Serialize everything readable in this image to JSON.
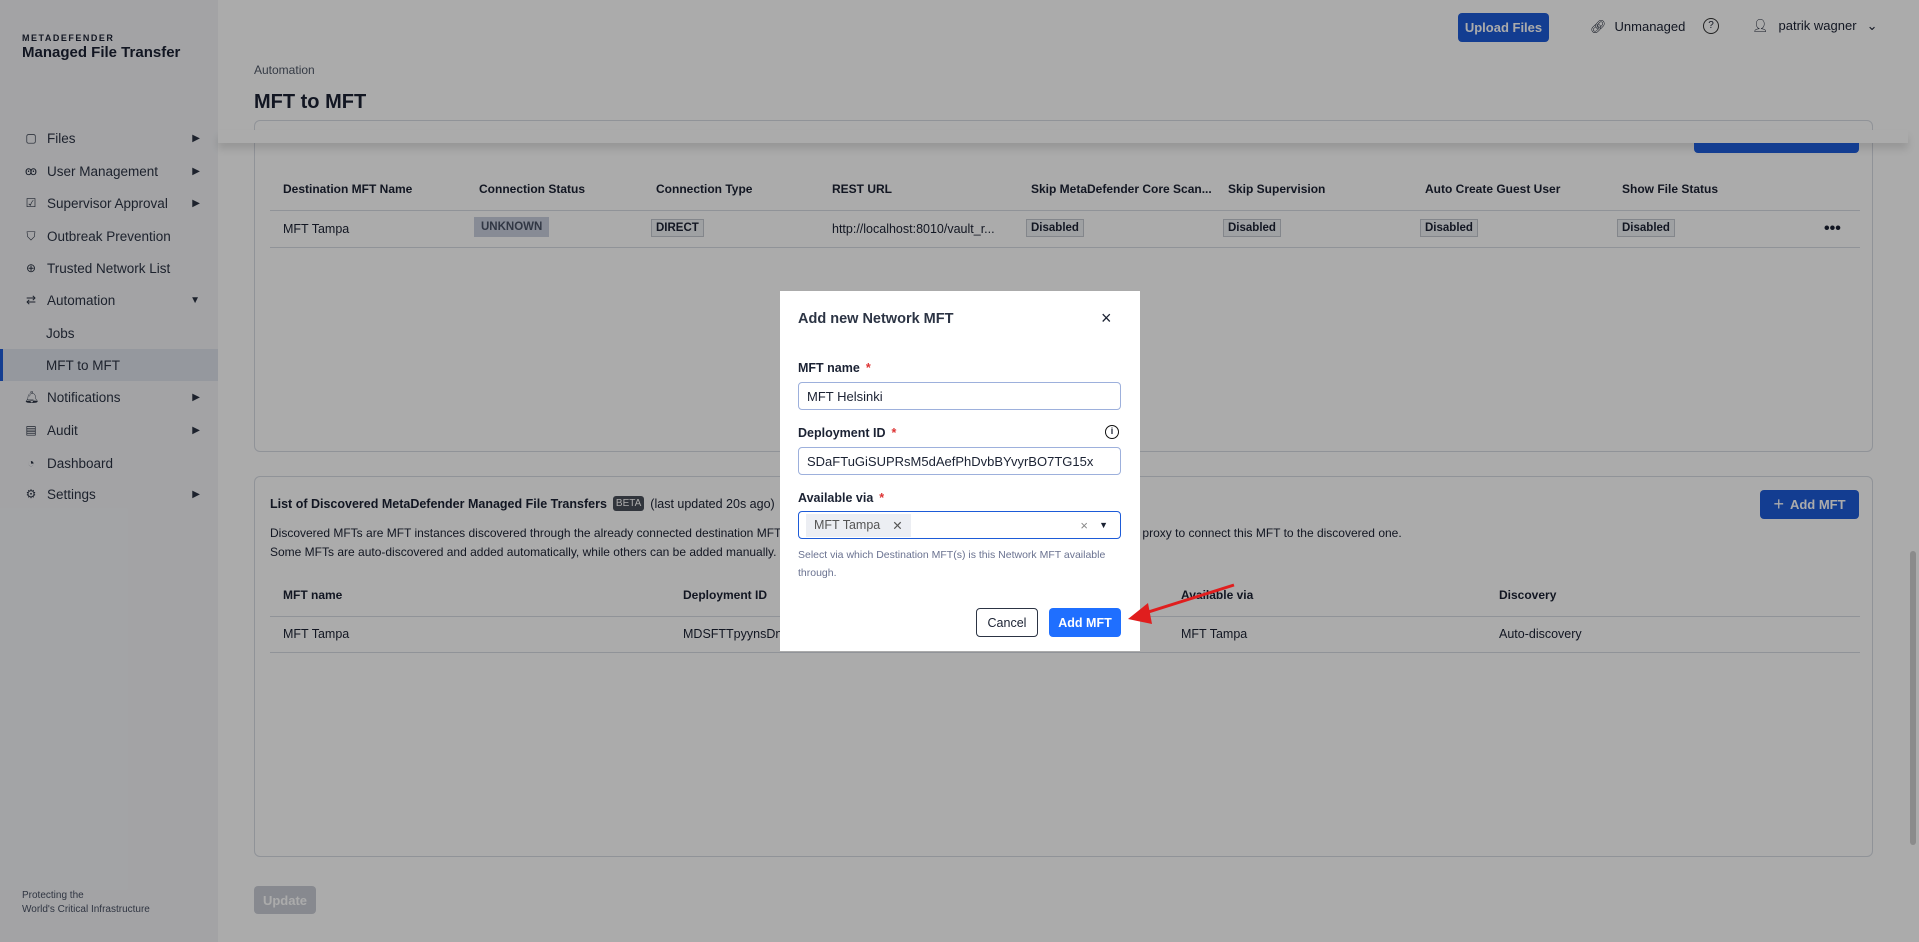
{
  "brand": {
    "top": "METADEFENDER",
    "name": "Managed File Transfer",
    "tagline_1": "Protecting the",
    "tagline_2": "World's Critical Infrastructure"
  },
  "header": {
    "upload": "Upload Files",
    "unmanaged": "Unmanaged",
    "user": "patrik wagner"
  },
  "sidebar": {
    "items": [
      {
        "label": "Files",
        "icon": "files-icon"
      },
      {
        "label": "User Management",
        "icon": "users-icon"
      },
      {
        "label": "Supervisor Approval",
        "icon": "approval-icon"
      },
      {
        "label": "Outbreak Prevention",
        "icon": "shield-icon"
      },
      {
        "label": "Trusted Network List",
        "icon": "globe-icon"
      },
      {
        "label": "Automation",
        "icon": "automation-icon"
      },
      {
        "label": "Jobs"
      },
      {
        "label": "MFT to MFT"
      },
      {
        "label": "Notifications",
        "icon": "bell-icon"
      },
      {
        "label": "Audit",
        "icon": "audit-icon"
      },
      {
        "label": "Dashboard",
        "icon": "dashboard-icon"
      },
      {
        "label": "Settings",
        "icon": "gear-icon"
      }
    ]
  },
  "page": {
    "breadcrumb": "Automation",
    "title": "MFT to MFT",
    "update": "Update"
  },
  "destinations": {
    "headers": [
      "Destination MFT Name",
      "Connection Status",
      "Connection Type",
      "REST URL",
      "Skip MetaDefender Core Scan...",
      "Skip Supervision",
      "Auto Create Guest User",
      "Show File Status"
    ],
    "rows": [
      [
        "MFT Tampa",
        "UNKNOWN",
        "DIRECT",
        "http://localhost:8010/vault_r...",
        "Disabled",
        "Disabled",
        "Disabled",
        "Disabled"
      ]
    ]
  },
  "discovered": {
    "title": "List of Discovered MetaDefender Managed File Transfers",
    "badge": "BETA",
    "updated": "(last updated 20s ago)",
    "add": "Add MFT",
    "desc_1": "Discovered MFTs are MFT instances discovered through the already connected destination MFTs. The connection is made through an intermediary MFT acting as a proxy to connect this MFT to the discovered one.",
    "desc_2": "Some MFTs are auto-discovered and added automatically, while others can be added manually.",
    "headers": [
      "MFT name",
      "Deployment ID",
      "Available via",
      "Discovery"
    ],
    "rows": [
      [
        "MFT Tampa",
        "MDSFTTpyynsDn",
        "MFT Tampa",
        "Auto-discovery"
      ]
    ]
  },
  "modal": {
    "title": "Add new Network MFT",
    "name_label": "MFT name",
    "name_value": "MFT Helsinki",
    "dep_label": "Deployment ID",
    "dep_value": "SDaFTuGiSUPRsM5dAefPhDvbBYvyrBO7TG15x",
    "via_label": "Available via",
    "via_chip": "MFT Tampa",
    "helper": "Select via which Destination MFT(s) is this Network MFT available through.",
    "cancel": "Cancel",
    "add": "Add MFT"
  }
}
